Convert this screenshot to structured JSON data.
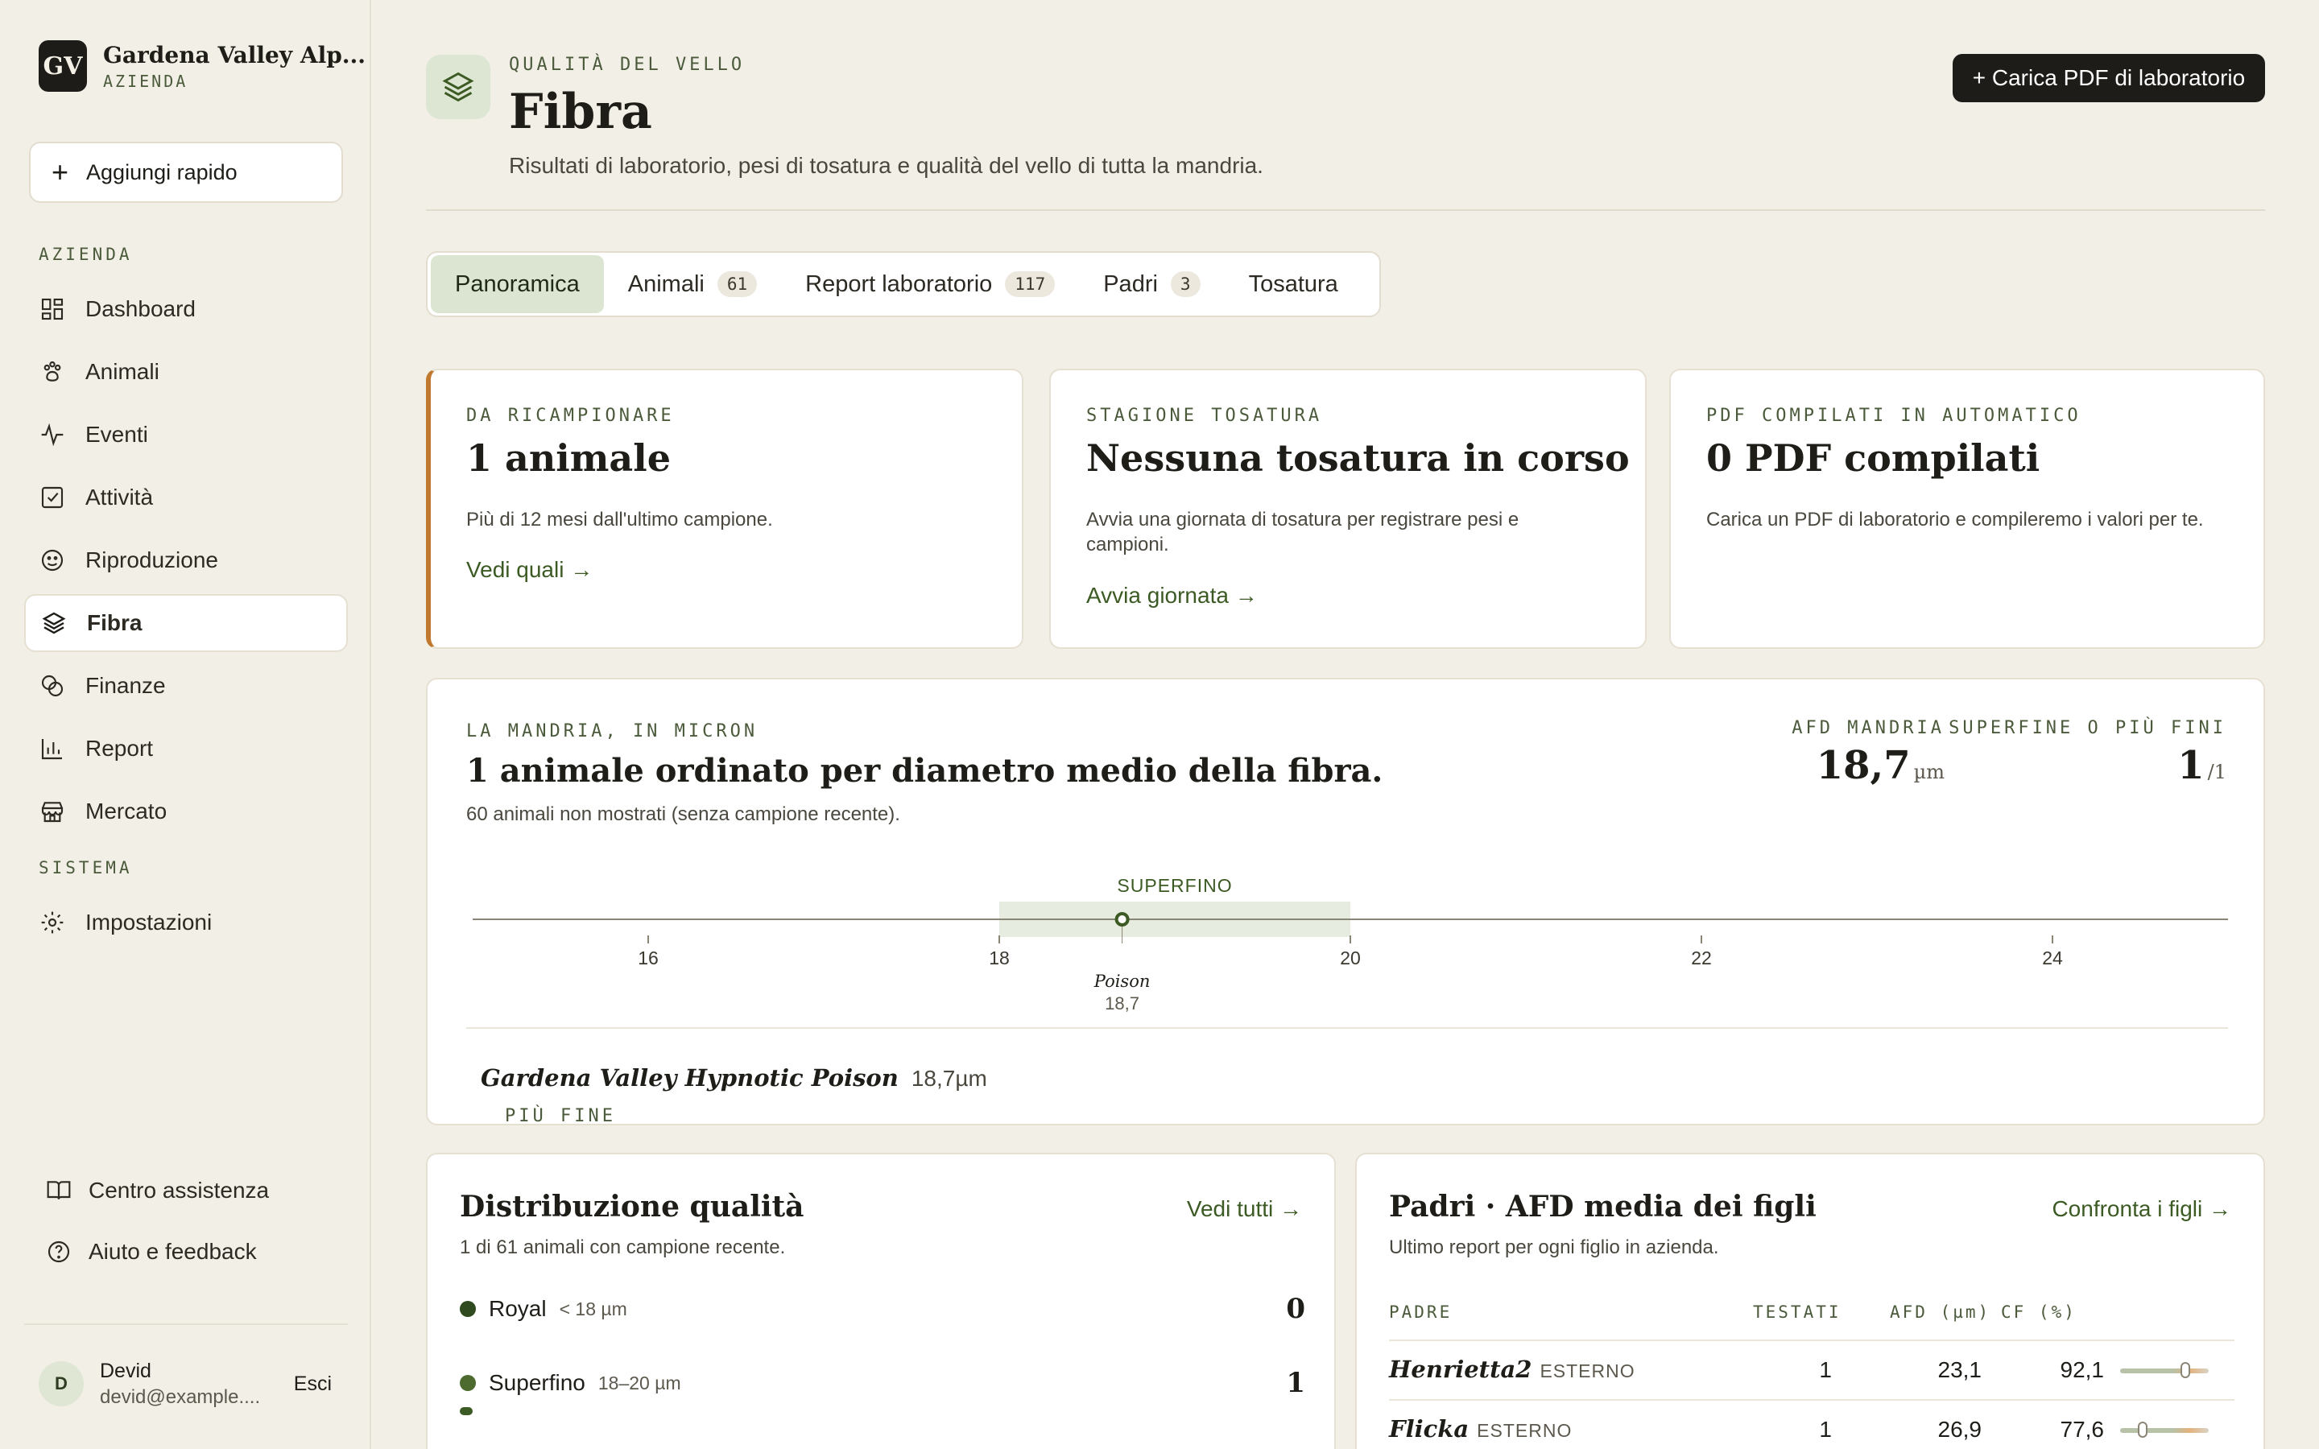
{
  "brand": {
    "initials": "GV",
    "name": "Gardena Valley Alp...",
    "sub": "AZIENDA"
  },
  "quick_add": "Aggiungi rapido",
  "sidebar": {
    "section_farm": "AZIENDA",
    "section_system": "SISTEMA",
    "items": [
      {
        "label": "Dashboard",
        "icon": "dashboard-icon"
      },
      {
        "label": "Animali",
        "icon": "paw-icon"
      },
      {
        "label": "Eventi",
        "icon": "activity-icon"
      },
      {
        "label": "Attività",
        "icon": "checkbox-icon"
      },
      {
        "label": "Riproduzione",
        "icon": "smile-icon"
      },
      {
        "label": "Fibra",
        "icon": "layers-icon",
        "active": true
      },
      {
        "label": "Finanze",
        "icon": "coins-icon"
      },
      {
        "label": "Report",
        "icon": "bar-chart-icon"
      },
      {
        "label": "Mercato",
        "icon": "store-icon"
      }
    ],
    "settings": "Impostazioni",
    "help_center": "Centro assistenza",
    "feedback": "Aiuto e feedback",
    "user": {
      "initial": "D",
      "name": "Devid",
      "email": "devid@example....",
      "logout": "Esci"
    }
  },
  "header": {
    "eyebrow": "QUALITÀ DEL VELLO",
    "title": "Fibra",
    "subtitle": "Risultati di laboratorio, pesi di tosatura e qualità del vello di tutta la mandria.",
    "upload_button": "+ Carica PDF di laboratorio"
  },
  "tabs": [
    {
      "label": "Panoramica",
      "count": null,
      "active": true
    },
    {
      "label": "Animali",
      "count": "61"
    },
    {
      "label": "Report laboratorio",
      "count": "117"
    },
    {
      "label": "Padri",
      "count": "3"
    },
    {
      "label": "Tosatura",
      "count": null
    }
  ],
  "cards": {
    "resample": {
      "eyebrow": "DA RICAMPIONARE",
      "value": "1 animale",
      "desc": "Più di 12 mesi dall'ultimo campione.",
      "link": "Vedi quali →"
    },
    "shearing": {
      "eyebrow": "STAGIONE TOSATURA",
      "value": "Nessuna tosatura in corso",
      "desc": "Avvia una giornata di tosatura per registrare pesi e campioni.",
      "link": "Avvia giornata →"
    },
    "pdf": {
      "eyebrow": "PDF COMPILATI IN AUTOMATICO",
      "value": "0 PDF compilati",
      "desc": "Carica un PDF di laboratorio e compileremo i valori per te."
    }
  },
  "herd": {
    "eyebrow": "LA MANDRIA, IN MICRON",
    "title": "1 animale ordinato per diametro medio della fibra.",
    "subtitle": "60 animali non mostrati (senza campione recente).",
    "afd_label": "AFD MANDRIA",
    "afd_value": "18,7",
    "afd_unit": "µm",
    "superfine_label": "SUPERFINE O PIÙ FINI",
    "superfine_value": "1",
    "superfine_total": "/1",
    "finest_label": "PIÙ FINE",
    "finest_name": "Gardena Valley Hypnotic Poison",
    "finest_value": "18,7µm"
  },
  "chart_data": {
    "type": "scatter",
    "x_domain": [
      15,
      25
    ],
    "ticks": [
      16,
      18,
      20,
      22,
      24
    ],
    "band": {
      "label": "SUPERFINO",
      "from": 18,
      "to": 20
    },
    "points": [
      {
        "name": "Poison",
        "value": 18.7,
        "label": "18,7"
      }
    ]
  },
  "distribution": {
    "title": "Distribuzione qualità",
    "subtitle": "1 di 61 animali con campione recente.",
    "link": "Vedi tutti →",
    "rows": [
      {
        "name": "Royal",
        "range": "< 18 µm",
        "count": "0",
        "color": "#2f4a1e"
      },
      {
        "name": "Superfino",
        "range": "18–20 µm",
        "count": "1",
        "color": "#4d6b2f"
      }
    ]
  },
  "sires": {
    "title": "Padri · AFD media dei figli",
    "subtitle": "Ultimo report per ogni figlio in azienda.",
    "link": "Confronta i figli →",
    "headers": {
      "sire": "PADRE",
      "tested": "TESTATI",
      "afd": "AFD (µm)",
      "cf": "CF (%)"
    },
    "rows": [
      {
        "name": "Henrietta2",
        "tag": "ESTERNO",
        "tested": "1",
        "afd": "23,1",
        "cf": "92,1",
        "cf_value": 92.1
      },
      {
        "name": "Flicka",
        "tag": "ESTERNO",
        "tested": "1",
        "afd": "26,9",
        "cf": "77,6",
        "cf_value": 77.6
      }
    ]
  }
}
